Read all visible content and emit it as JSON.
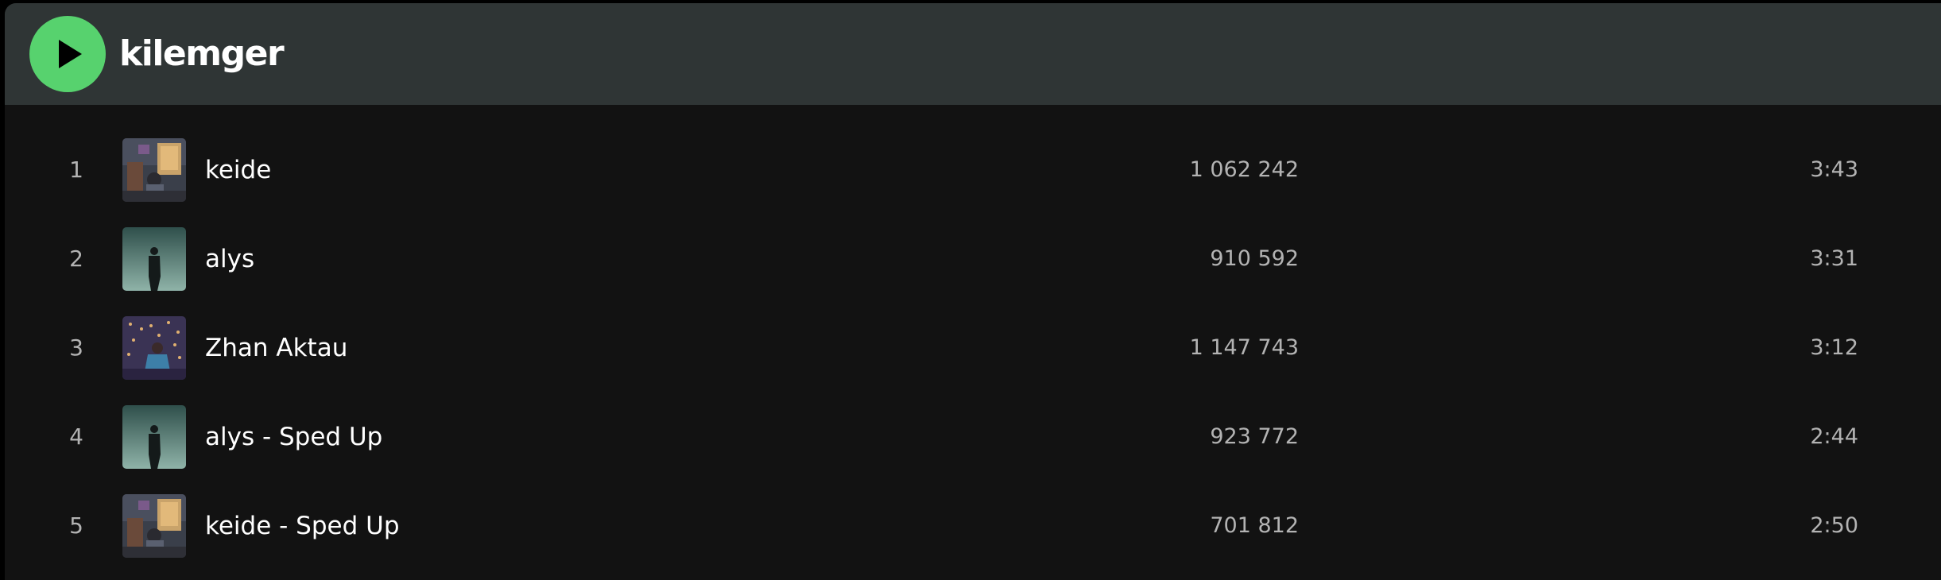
{
  "artist": {
    "name": "kilemger"
  },
  "header": {
    "play_icon": "play-icon",
    "background_color": "#2f3535",
    "play_button_color": "#57d26e"
  },
  "tracks": [
    {
      "number": "1",
      "title": "keide",
      "plays": "1 062 242",
      "duration": "3:43",
      "cover": "album-cover-keide"
    },
    {
      "number": "2",
      "title": "alys",
      "plays": "910 592",
      "duration": "3:31",
      "cover": "album-cover-alys"
    },
    {
      "number": "3",
      "title": "Zhan Aktau",
      "plays": "1 147 743",
      "duration": "3:12",
      "cover": "album-cover-zhan-aktau"
    },
    {
      "number": "4",
      "title": "alys - Sped Up",
      "plays": "923 772",
      "duration": "2:44",
      "cover": "album-cover-alys"
    },
    {
      "number": "5",
      "title": "keide - Sped Up",
      "plays": "701 812",
      "duration": "2:50",
      "cover": "album-cover-keide"
    }
  ]
}
